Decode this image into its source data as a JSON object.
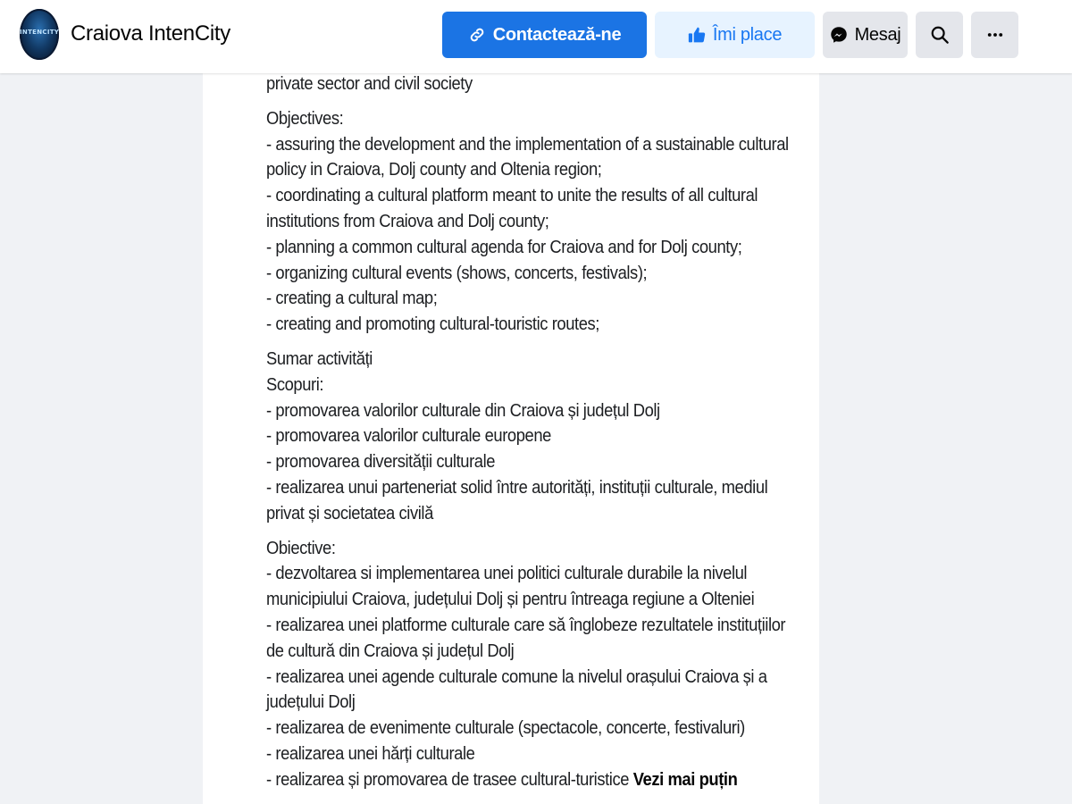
{
  "header": {
    "avatar_logo_text": "INTENCITY",
    "page_name": "Craiova IntenCity",
    "buttons": {
      "contact": "Contactează-ne",
      "like": "Îmi place",
      "message": "Mesaj"
    },
    "icons": {
      "contact": "link-icon",
      "like": "thumbs-up-icon",
      "message": "messenger-icon",
      "search": "search-icon",
      "more": "more-icon"
    },
    "colors": {
      "primary": "#1b74e4",
      "like_bg": "#e7f3ff",
      "like_text": "#1877f2",
      "secondary_bg": "#e4e6eb"
    }
  },
  "about": {
    "p1": [
      "private sector and civil society"
    ],
    "p2": [
      "Objectives:",
      "- assuring the development and the implementation of a sustainable cultural",
      "policy in Craiova, Dolj county and Oltenia region;",
      "- coordinating a cultural platform meant to unite the results of all cultural",
      "institutions from Craiova and Dolj county;",
      "- planning a common cultural agenda for Craiova and for Dolj county;",
      "- organizing cultural events (shows, concerts, festivals);",
      "- creating a cultural map;",
      "- creating and promoting cultural-touristic routes;"
    ],
    "p3": [
      "Sumar activități",
      "Scopuri:",
      "- promovarea valorilor culturale din Craiova și județul Dolj",
      "- promovarea valorilor culturale europene",
      "- promovarea diversității culturale",
      "- realizarea unui parteneriat solid între autorități, instituții culturale, mediul",
      "privat și societatea civilă"
    ],
    "p4": [
      "Obiective:",
      "- dezvoltarea si implementarea unei politici culturale durabile la nivelul",
      "municipiului Craiova, județului Dolj și pentru întreaga regiune a Olteniei",
      "- realizarea unei platforme culturale care să înglobeze rezultatele instituțiilor",
      "de cultură din Craiova și județul Dolj",
      "- realizarea unei agende culturale comune la nivelul orașului Craiova și a",
      "județului Dolj",
      "- realizarea de evenimente culturale (spectacole, concerte, festivaluri)",
      "- realizarea unei hărți culturale"
    ],
    "last_line": "- realizarea și promovarea de trasee cultural-turistice",
    "see_less": "Vezi mai puțin"
  }
}
